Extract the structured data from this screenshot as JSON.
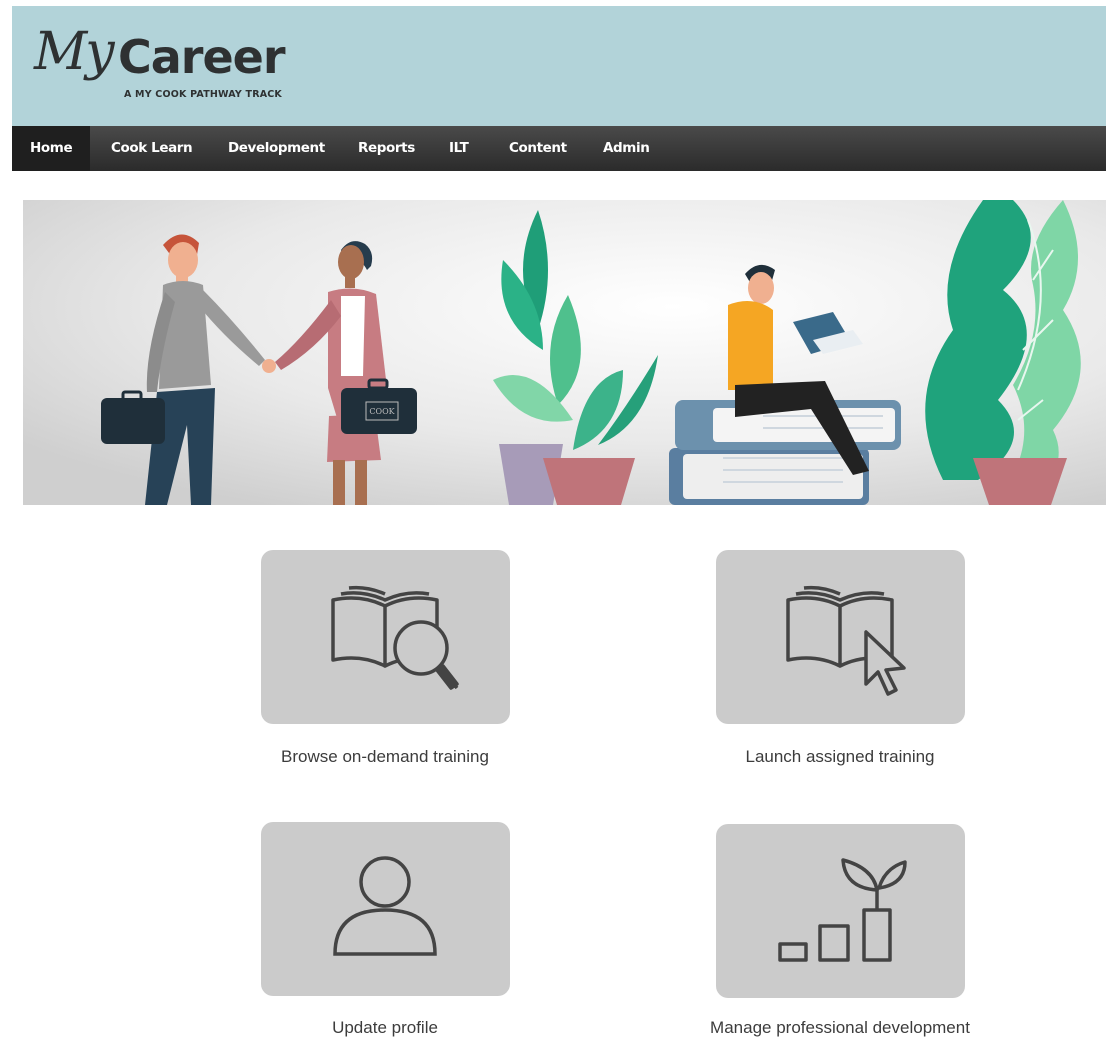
{
  "logo": {
    "script": "My",
    "word": "Career",
    "tagline": "A MY COOK PATHWAY TRACK"
  },
  "nav": {
    "items": [
      {
        "label": "Home",
        "active": true
      },
      {
        "label": "Cook Learn"
      },
      {
        "label": "Development"
      },
      {
        "label": "Reports"
      },
      {
        "label": "ILT"
      },
      {
        "label": "Content"
      },
      {
        "label": "Admin"
      }
    ]
  },
  "banner": {
    "briefcase_text": "COOK",
    "icons": [
      "handshake-people",
      "plant",
      "reader-on-books",
      "plant"
    ]
  },
  "tiles": [
    {
      "label": "Browse on-demand training",
      "icon": "book-magnifier-icon"
    },
    {
      "label": "Launch assigned training",
      "icon": "book-cursor-icon"
    },
    {
      "label": "Update profile",
      "icon": "person-icon"
    },
    {
      "label": "Manage professional development",
      "icon": "growth-chart-icon"
    }
  ],
  "colors": {
    "header_bg": "#b2d3d9",
    "nav_bg": "#333333",
    "tile_bg": "#cbcbcb",
    "icon_stroke": "#444444"
  }
}
